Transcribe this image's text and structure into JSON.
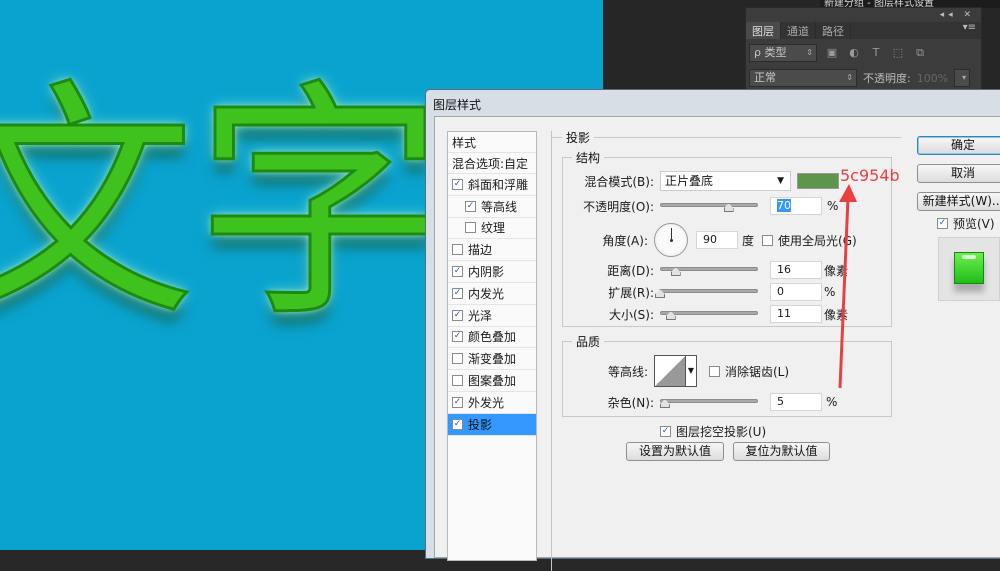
{
  "canvas": {
    "text_chars": [
      "文",
      "字"
    ],
    "background": "#0aa3cf",
    "text_color": "#3fc21e"
  },
  "top_strip": {
    "text": "新建分组 - 图层样式设置"
  },
  "layers_panel": {
    "tabs": [
      {
        "label": "图层",
        "active": true
      },
      {
        "label": "通道",
        "active": false
      },
      {
        "label": "路径",
        "active": false
      }
    ],
    "filter_kind": "ρ 类型",
    "blend_mode": "正常",
    "opacity_label": "不透明度:",
    "opacity_value": "100%"
  },
  "dialog": {
    "title": "图层样式",
    "styles_list": {
      "header": "样式",
      "blend_options": "混合选项:自定",
      "items": [
        {
          "label": "斜面和浮雕",
          "checked": true,
          "indent": false,
          "selected": false
        },
        {
          "label": "等高线",
          "checked": true,
          "indent": true,
          "selected": false
        },
        {
          "label": "纹理",
          "checked": false,
          "indent": true,
          "selected": false
        },
        {
          "label": "描边",
          "checked": false,
          "indent": false,
          "selected": false
        },
        {
          "label": "内阴影",
          "checked": true,
          "indent": false,
          "selected": false
        },
        {
          "label": "内发光",
          "checked": true,
          "indent": false,
          "selected": false
        },
        {
          "label": "光泽",
          "checked": true,
          "indent": false,
          "selected": false
        },
        {
          "label": "颜色叠加",
          "checked": true,
          "indent": false,
          "selected": false
        },
        {
          "label": "渐变叠加",
          "checked": false,
          "indent": false,
          "selected": false
        },
        {
          "label": "图案叠加",
          "checked": false,
          "indent": false,
          "selected": false
        },
        {
          "label": "外发光",
          "checked": true,
          "indent": false,
          "selected": false
        },
        {
          "label": "投影",
          "checked": true,
          "indent": false,
          "selected": true
        }
      ]
    },
    "section_title": "投影",
    "structure": {
      "title": "结构",
      "blend_mode_label": "混合模式(B):",
      "blend_mode_value": "正片叠底",
      "shadow_color": "#5c954b",
      "opacity_label": "不透明度(O):",
      "opacity_value": "70",
      "opacity_fraction": 0.7,
      "percent_unit": "%",
      "angle_label": "角度(A):",
      "angle_value": "90",
      "angle_unit": "度",
      "global_light_label": "使用全局光(G)",
      "global_light_checked": false,
      "distance_label": "距离(D):",
      "distance_value": "16",
      "distance_fraction": 0.16,
      "pixel_unit": "像素",
      "spread_label": "扩展(R):",
      "spread_value": "0",
      "spread_fraction": 0.0,
      "size_label": "大小(S):",
      "size_value": "11",
      "size_fraction": 0.11
    },
    "quality": {
      "title": "品质",
      "contour_label": "等高线:",
      "anti_alias_label": "消除锯齿(L)",
      "anti_alias_checked": false,
      "noise_label": "杂色(N):",
      "noise_value": "5",
      "noise_fraction": 0.05
    },
    "knockout_label": "图层挖空投影(U)",
    "knockout_checked": true,
    "make_default_label": "设置为默认值",
    "reset_default_label": "复位为默认值",
    "ok_label": "确定",
    "cancel_label": "取消",
    "new_style_label": "新建样式(W)...",
    "preview_label": "预览(V)",
    "preview_checked": true
  },
  "annotation": {
    "text": "5c954b",
    "color": "#e84040"
  }
}
